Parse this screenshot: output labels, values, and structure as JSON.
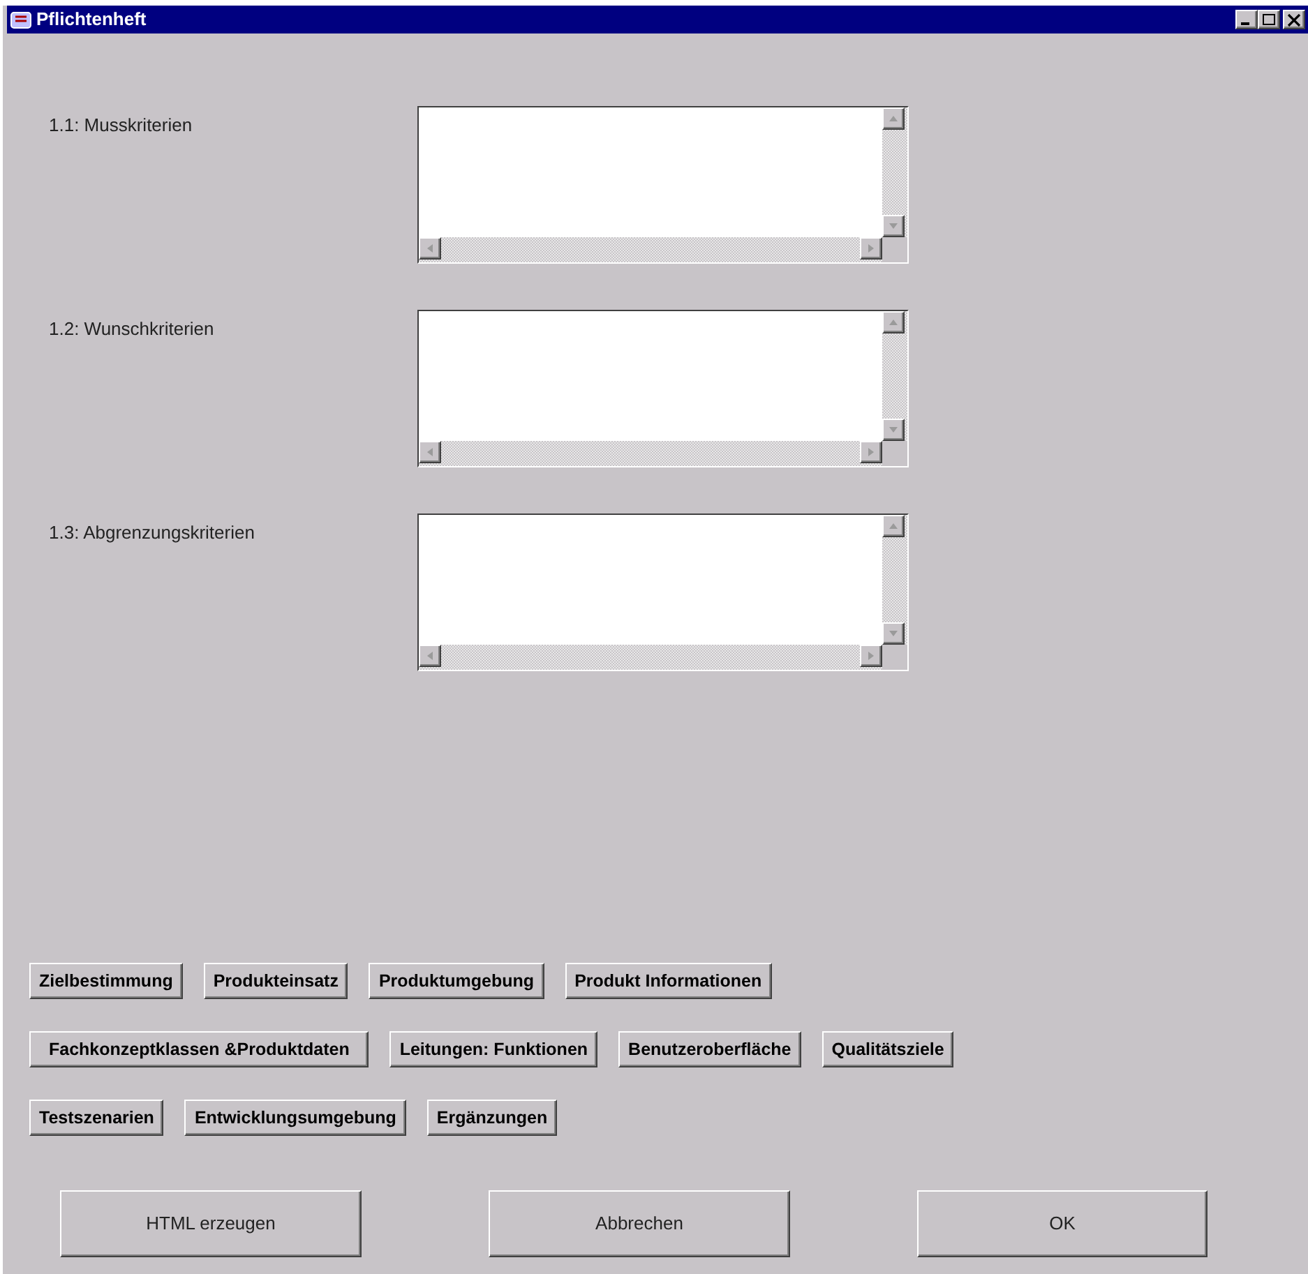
{
  "window": {
    "title": "Pflichtenheft"
  },
  "fields": [
    {
      "label": "1.1: Musskriterien"
    },
    {
      "label": "1.2: Wunschkriterien"
    },
    {
      "label": "1.3: Abgrenzungskriterien"
    }
  ],
  "section_buttons": [
    [
      "Zielbestimmung",
      "Produkteinsatz",
      "Produktumgebung",
      "Produkt Informationen"
    ],
    [
      "Fachkonzeptklassen &Produktdaten",
      "Leitungen: Funktionen",
      "Benutzeroberfläche",
      "Qualitätsziele"
    ],
    [
      "Testszenarien",
      "Entwicklungsumgebung",
      "Ergänzungen"
    ]
  ],
  "action_buttons": [
    "HTML erzeugen",
    "Abbrechen",
    "OK"
  ]
}
